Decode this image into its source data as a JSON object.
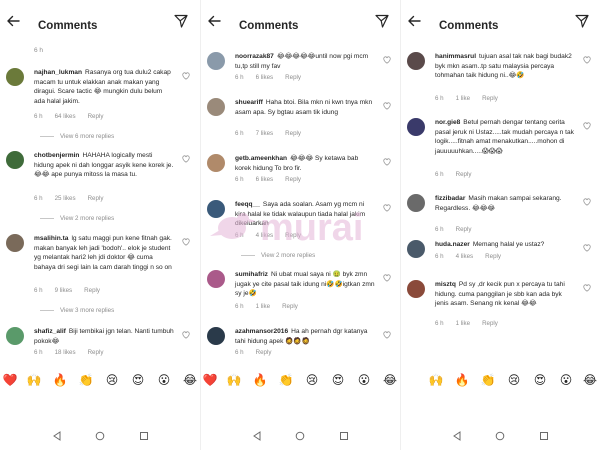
{
  "header": {
    "title": "Comments"
  },
  "panels": [
    {
      "top_time": "6 h",
      "comments": [
        {
          "user": "najhan_lukman",
          "text": "Rasanya org tua dulu2 cakap macam tu untuk elakkan anak makan yang diragui. Scare tactic 😂 mungkin dulu belum ada halal jakim.",
          "time": "6 h",
          "likes": "64 likes",
          "reply": "Reply",
          "view_replies": "View 6 more replies",
          "avatar_color": "#6b7a3a"
        },
        {
          "user": "chotbenjermin",
          "text": "HAHAHA logically mesti hidung apek ni dah longgar asyik kene korek je. 😂😂 ape punya mitoss la masa tu.",
          "time": "6 h",
          "likes": "25 likes",
          "reply": "Reply",
          "view_replies": "View 2 more replies",
          "avatar_color": "#3f6b3a"
        },
        {
          "user": "msalihin.ta",
          "text": "lg satu maggi pun kene fitnah gak. makan banyak leh jadi 'bodoh'.. elok je student yg melantak hari2 leh jdi doktor 😂 cuma bahaya dri segi lain la cam darah tinggi n so on",
          "time": "6 h",
          "likes": "9 likes",
          "reply": "Reply",
          "view_replies": "View 3 more replies",
          "avatar_color": "#7a6a5a"
        },
        {
          "user": "shafiz_alif",
          "text": "Biji tembikai jgn telan. Nanti tumbuh pokok😂",
          "time": "6 h",
          "likes": "18 likes",
          "reply": "Reply",
          "view_replies": "",
          "avatar_color": "#5a9a6a"
        }
      ]
    },
    {
      "top_time": "",
      "comments": [
        {
          "user": "noorrazak87",
          "text": "😂😂😂😂😂until now pgi mcm tu,tp still my fav",
          "time": "6 h",
          "likes": "6 likes",
          "reply": "Reply",
          "view_replies": "",
          "avatar_color": "#8a9aaa"
        },
        {
          "user": "shueariff",
          "text": "Haha btoi. Bila mkn ni kwn tnya mkn asam apa. Sy bgtau asam tik idung",
          "time": "6 h",
          "likes": "7 likes",
          "reply": "Reply",
          "view_replies": "",
          "avatar_color": "#9a8a7a"
        },
        {
          "user": "getb.ameenkhan",
          "text": "😂😂😂 Sy ketawa bab korek hidung To bro fir.",
          "time": "6 h",
          "likes": "6 likes",
          "reply": "Reply",
          "view_replies": "",
          "avatar_color": "#b08a6a"
        },
        {
          "user": "feeqq__",
          "text": "Saya ada soalan. Asam yg mcm ni kira halal ke tidak walaupun tiada halal jakim dikeluarkan",
          "time": "6 h",
          "likes": "4 likes",
          "reply": "Reply",
          "view_replies": "View 2 more replies",
          "avatar_color": "#3a5a7a"
        },
        {
          "user": "sumihafriz",
          "text": "Ni ubat mual saya ni 🤢 byk zmn jugak ye cite pasal taik idung ni🤣🤣igtkan zmn sy je🤣",
          "time": "6 h",
          "likes": "1 like",
          "reply": "Reply",
          "view_replies": "",
          "avatar_color": "#aa5a8a"
        },
        {
          "user": "azahmansor2016",
          "text": "Ha ah pernah dgr katanya tahi hidung apek 🧔🧔🧔",
          "time": "6 h",
          "likes": "",
          "reply": "Reply",
          "view_replies": "",
          "avatar_color": "#2a3a4a"
        }
      ]
    },
    {
      "top_time": "",
      "comments": [
        {
          "user": "hanimmasrul",
          "text": "tujuan asal tak nak bagi budak2 byk mkn asam..tp satu malaysia percaya tohmahan taik hidung ni..😂🤣",
          "time": "6 h",
          "likes": "1 like",
          "reply": "Reply",
          "view_replies": "",
          "avatar_color": "#5a4a4a"
        },
        {
          "user": "nor.gie8",
          "text": "Betul pernah dengar tentang cerita pasal jeruk ni Ustaz.....tak mudah percaya n tak logik.....fitnah amat menakutkan.....mohon di jauuuuuhkan.....😱😱😱",
          "time": "6 h",
          "likes": "",
          "reply": "Reply",
          "view_replies": "",
          "avatar_color": "#3a3a6a"
        },
        {
          "user": "fizzibadar",
          "text": "Masih makan sampai sekarang. Regardless. 😂😂😂",
          "time": "6 h",
          "likes": "",
          "reply": "Reply",
          "view_replies": "",
          "avatar_color": "#6a6a6a"
        },
        {
          "user": "huda.nazer",
          "text": "Memang halal ye ustaz?",
          "time": "6 h",
          "likes": "4 likes",
          "reply": "Reply",
          "view_replies": "",
          "avatar_color": "#4a5a6a"
        },
        {
          "user": "misztq",
          "text": "Pd sy ,dr kecik pun x percaya tu tahi hidung. cuma panggilan je sbb kan ada byk jenis asam. Senang nk kenal 😂😂",
          "time": "6 h",
          "likes": "1 like",
          "reply": "Reply",
          "view_replies": "",
          "avatar_color": "#8a4a3a"
        }
      ]
    }
  ],
  "emoji_bar": [
    "❤️",
    "🙌",
    "🔥",
    "👏",
    "😢",
    "😍",
    "😮",
    "😂"
  ],
  "watermark": "murai",
  "colors": {
    "text": "#262626",
    "muted": "#8e8e8e",
    "watermark": "#e4b5d8"
  }
}
